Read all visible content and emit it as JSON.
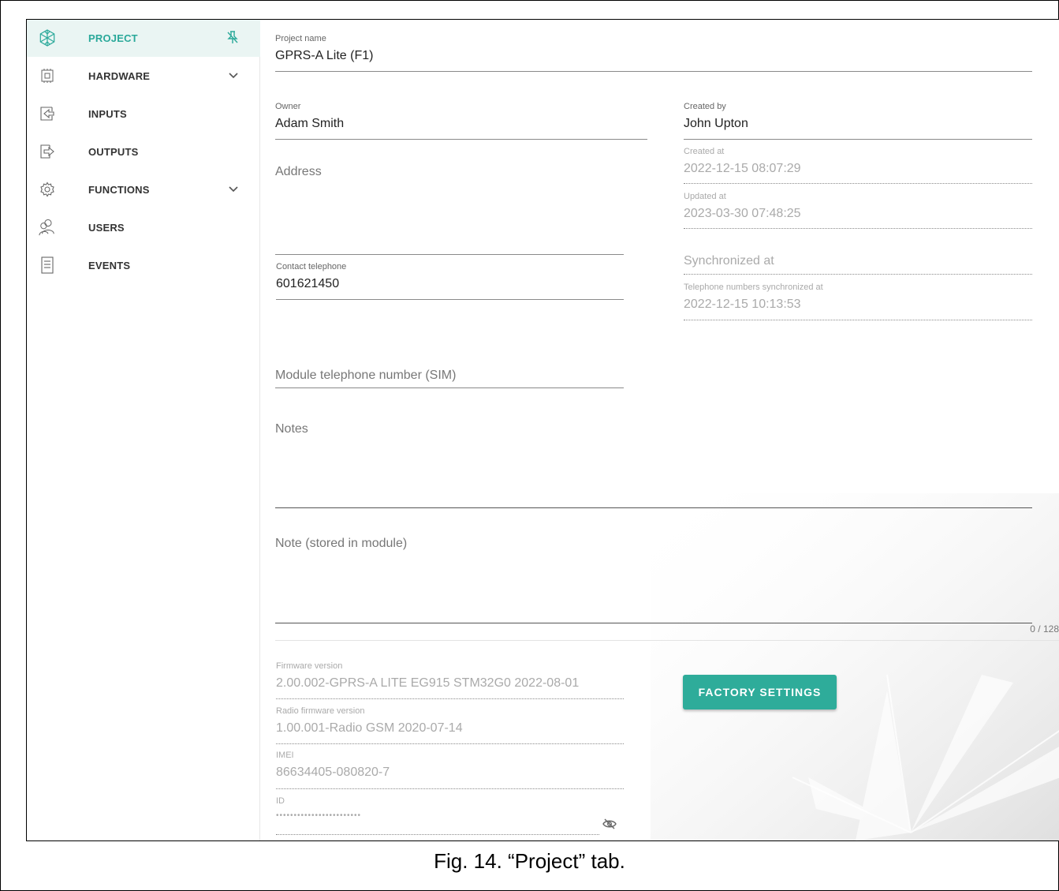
{
  "sidebar": {
    "items": [
      {
        "label": "PROJECT",
        "icon": "snowflake-logo-icon",
        "active": true
      },
      {
        "label": "HARDWARE",
        "icon": "chip-icon",
        "expandable": true
      },
      {
        "label": "INPUTS",
        "icon": "input-arrow-icon"
      },
      {
        "label": "OUTPUTS",
        "icon": "output-arrow-icon"
      },
      {
        "label": "FUNCTIONS",
        "icon": "gear-icon",
        "expandable": true
      },
      {
        "label": "USERS",
        "icon": "users-icon"
      },
      {
        "label": "EVENTS",
        "icon": "document-list-icon"
      }
    ],
    "pin_icon": "unpin-icon"
  },
  "project": {
    "name_label": "Project name",
    "name_value": "GPRS-A Lite (F1)",
    "owner_label": "Owner",
    "owner_value": "Adam Smith",
    "address_placeholder": "Address",
    "contact_label": "Contact telephone",
    "contact_value": "601621450",
    "module_phone_placeholder": "Module telephone number (SIM)",
    "notes_placeholder": "Notes",
    "module_note_placeholder": "Note (stored in module)",
    "module_note_counter": "0 / 128",
    "created_by_label": "Created by",
    "created_by_value": "John Upton",
    "created_at_label": "Created at",
    "created_at_value": "2022-12-15 08:07:29",
    "updated_at_label": "Updated at",
    "updated_at_value": "2023-03-30 07:48:25",
    "synchronized_placeholder": "Synchronized at",
    "phone_sync_label": "Telephone numbers synchronized at",
    "phone_sync_value": "2022-12-15 10:13:53"
  },
  "device": {
    "firmware_label": "Firmware version",
    "firmware_value": "2.00.002-GPRS-A LITE EG915 STM32G0 2022-08-01",
    "radio_label": "Radio firmware version",
    "radio_value": "1.00.001-Radio GSM 2020-07-14",
    "imei_label": "IMEI",
    "imei_value": "86634405-080820-7",
    "id_label": "ID",
    "id_value": "••••••••••••••••••••••••",
    "factory_button": "FACTORY SETTINGS"
  },
  "colors": {
    "accent": "#2eac9a",
    "active_bg": "#eaf5f3"
  },
  "caption": "Fig. 14. “Project” tab."
}
